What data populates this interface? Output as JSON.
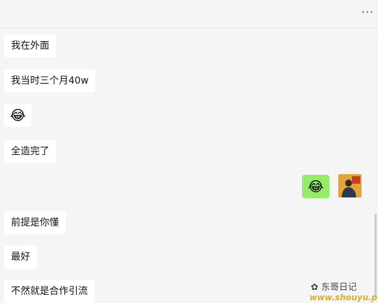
{
  "header": {
    "more_label": "···"
  },
  "messages": [
    {
      "side": "left",
      "type": "text",
      "text": "我在外面"
    },
    {
      "side": "left",
      "type": "text",
      "text": "我当时三个月40w"
    },
    {
      "side": "left",
      "type": "emoji",
      "icon": "laugh-cry-emoji"
    },
    {
      "side": "left",
      "type": "text",
      "text": "全造完了"
    },
    {
      "side": "right",
      "type": "emoji",
      "icon": "laugh-cry-emoji"
    },
    {
      "side": "left",
      "type": "text",
      "text": "前提是你懂"
    },
    {
      "side": "left",
      "type": "text",
      "text": "最好"
    },
    {
      "side": "left",
      "type": "text",
      "text": "不然就是合作引流"
    }
  ],
  "emoji_glyph": "😂",
  "watermark": {
    "name": "东哥日记",
    "url": "www.shouyu.pw"
  },
  "colors": {
    "background": "#f5f5f5",
    "incoming_bubble": "#ffffff",
    "outgoing_bubble": "#95ec69"
  }
}
